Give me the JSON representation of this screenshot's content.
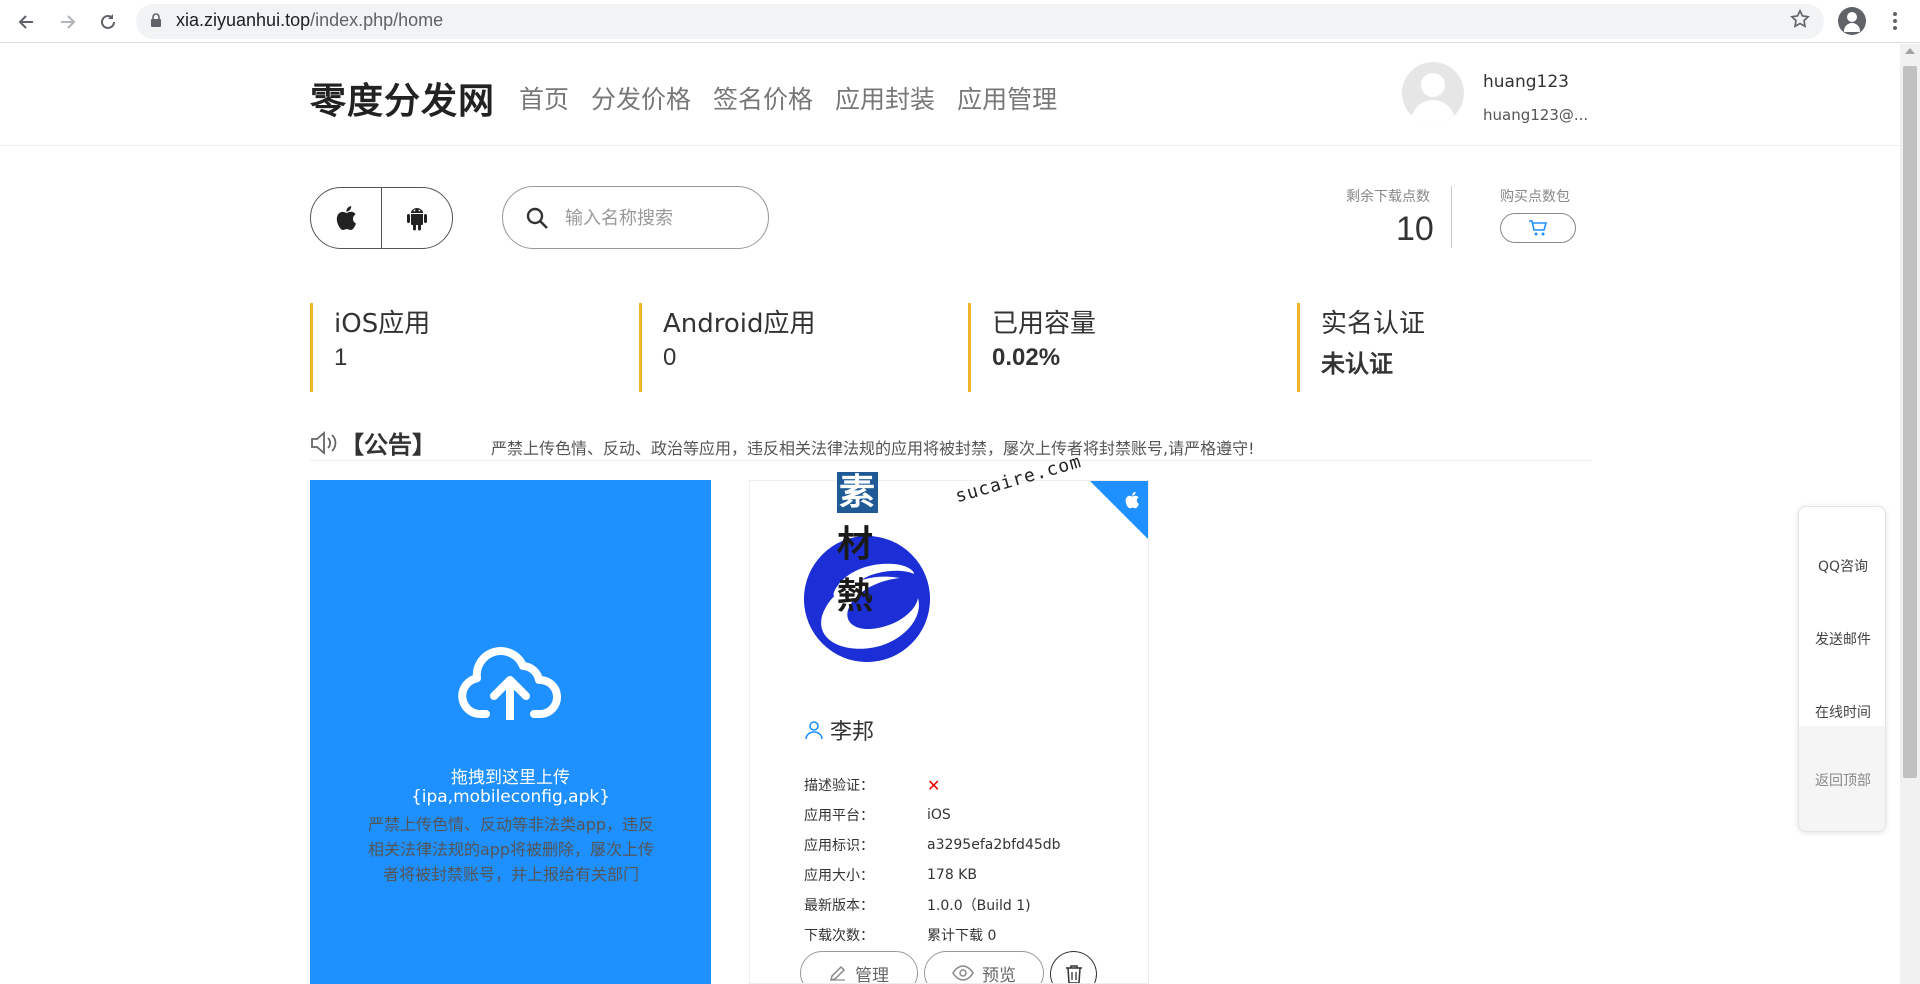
{
  "browser": {
    "url_host": "xia.ziyuanhui.top",
    "url_path": "/index.php/home"
  },
  "header": {
    "brand": "零度分发网",
    "menu": [
      "首页",
      "分发价格",
      "签名价格",
      "应用封装",
      "应用管理"
    ],
    "username": "huang123",
    "email": "huang123@..."
  },
  "toolbar": {
    "search_placeholder": "输入名称搜索",
    "remain_label": "剩余下载点数",
    "remain_value": "10",
    "buy_label": "购买点数包"
  },
  "stats": [
    {
      "label": "iOS应用",
      "value": "1"
    },
    {
      "label": "Android应用",
      "value": "0"
    },
    {
      "label": "已用容量",
      "value": "0.02%"
    },
    {
      "label": "实名认证",
      "value": "未认证"
    }
  ],
  "notice": {
    "title": "【公告】",
    "text": "严禁上传色情、反动、政治等应用，违反相关法律法规的应用将被封禁，屡次上传者将封禁账号,请严格遵守!"
  },
  "upload": {
    "title": "拖拽到这里上传",
    "types": "{ipa,mobileconfig,apk}",
    "warning": "严禁上传色情、反动等非法类app，违反相关法律法规的app将被删除，屡次上传者将被封禁账号，并上报给有关部门"
  },
  "app": {
    "name": "李邦",
    "fields": [
      {
        "key": "描述验证：",
        "value": "✕"
      },
      {
        "key": "应用平台：",
        "value": "iOS"
      },
      {
        "key": "应用标识：",
        "value": "a3295efa2bfd45db"
      },
      {
        "key": "应用大小：",
        "value": "178 KB"
      },
      {
        "key": "最新版本：",
        "value": "1.0.0（Build 1)"
      },
      {
        "key": "下载次数：",
        "value": "累计下载 0"
      }
    ],
    "manage_label": "管理",
    "preview_label": "预览"
  },
  "watermark": {
    "first_char": "素",
    "rest": "材熱",
    "domain": "sucaire.com"
  },
  "float_panel": [
    "QQ咨询",
    "发送邮件",
    "在线时间",
    "返回顶部"
  ],
  "colors": {
    "accent_blue": "#1e90ff",
    "stat_border": "#f0b429",
    "error_red": "#ee0000"
  }
}
